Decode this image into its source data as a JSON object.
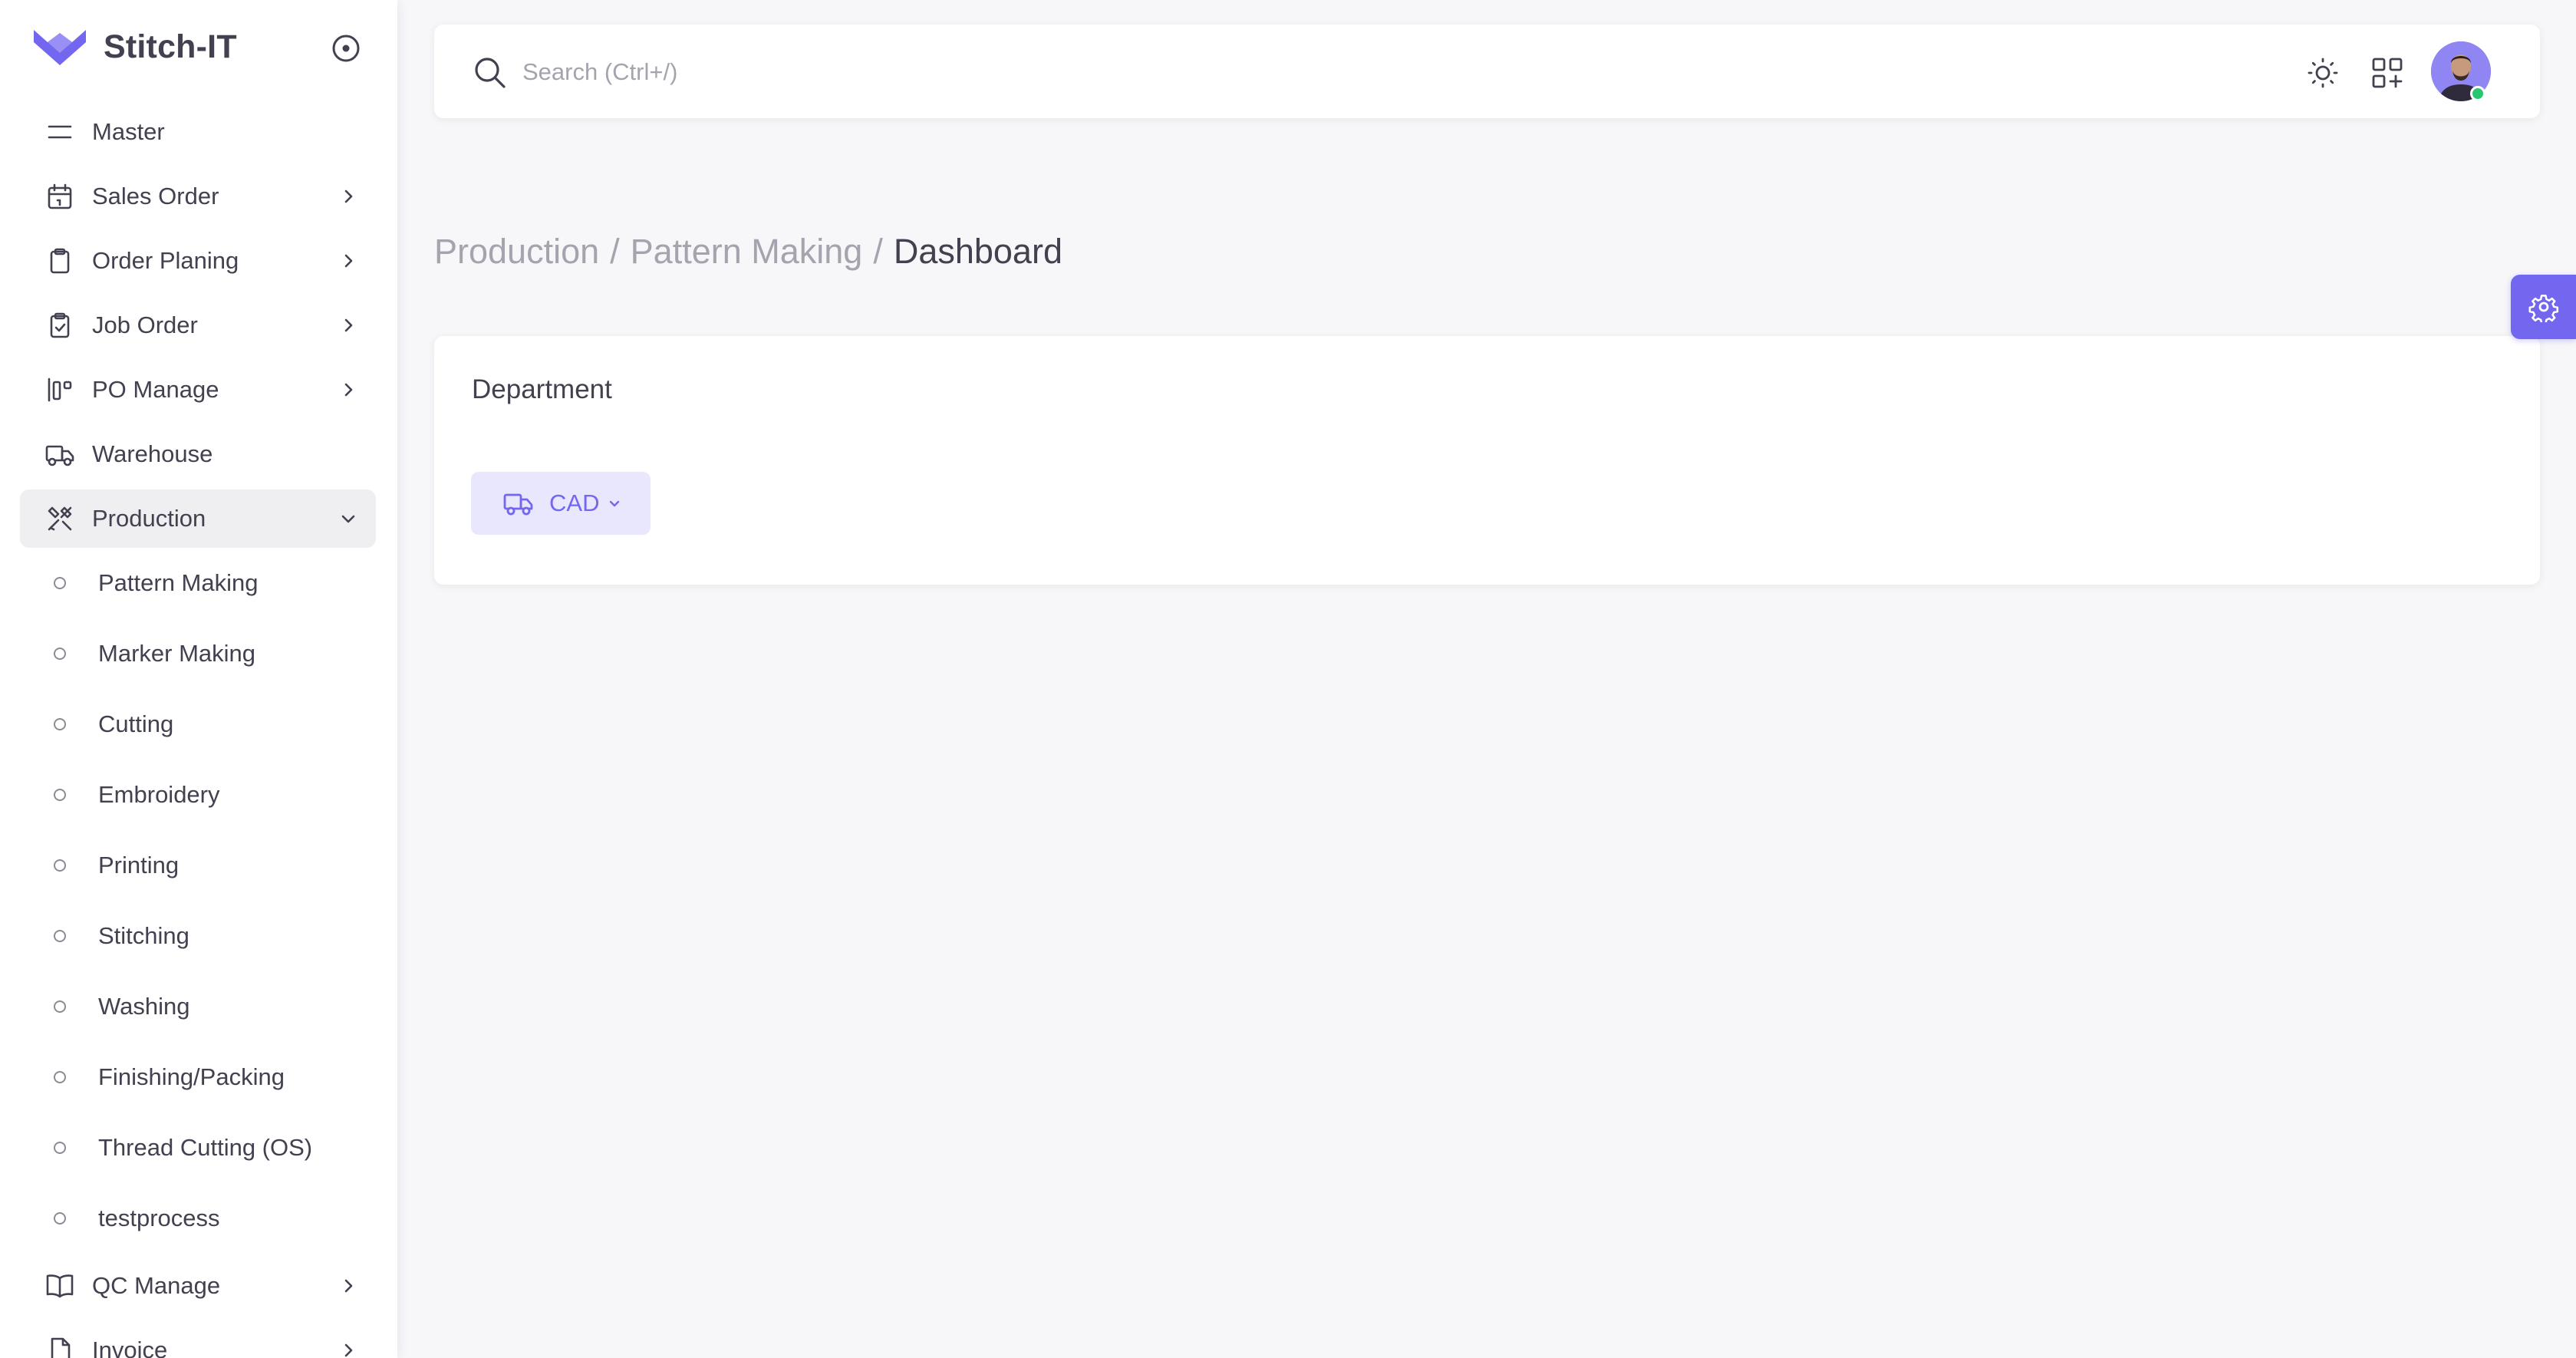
{
  "brand": {
    "name": "Stitch-IT",
    "accent": "#7367f0"
  },
  "sidebar": {
    "items": [
      {
        "label": "Master",
        "icon": "menu-lines-icon",
        "has_chevron": false
      },
      {
        "label": "Sales Order",
        "icon": "calendar-icon",
        "has_chevron": true
      },
      {
        "label": "Order Planing",
        "icon": "clipboard-icon",
        "has_chevron": true
      },
      {
        "label": "Job Order",
        "icon": "clipboard-check-icon",
        "has_chevron": true
      },
      {
        "label": "PO Manage",
        "icon": "layout-icon",
        "has_chevron": true
      },
      {
        "label": "Warehouse",
        "icon": "truck-icon",
        "has_chevron": false
      },
      {
        "label": "Production",
        "icon": "tools-icon",
        "has_chevron": true,
        "expanded": true
      }
    ],
    "production_sub": [
      "Pattern Making",
      "Marker Making",
      "Cutting",
      "Embroidery",
      "Printing",
      "Stitching",
      "Washing",
      "Finishing/Packing",
      "Thread Cutting (OS)",
      "testprocess"
    ],
    "bottom_items": [
      {
        "label": "QC Manage",
        "icon": "book-icon",
        "has_chevron": true
      },
      {
        "label": "Invoice",
        "icon": "file-icon",
        "has_chevron": true
      }
    ]
  },
  "topbar": {
    "search_placeholder": "Search (Ctrl+/)",
    "user_status": "online"
  },
  "breadcrumb": {
    "parts": [
      "Production",
      "Pattern Making"
    ],
    "separator": "/",
    "current": "Dashboard"
  },
  "card": {
    "title": "Department",
    "department_button": "CAD"
  },
  "colors": {
    "accent": "#7367f0",
    "accent_light": "#e9e7fd",
    "text": "#444050",
    "muted": "#a5a3ae",
    "online": "#28c76f",
    "background": "#f7f7f9"
  }
}
